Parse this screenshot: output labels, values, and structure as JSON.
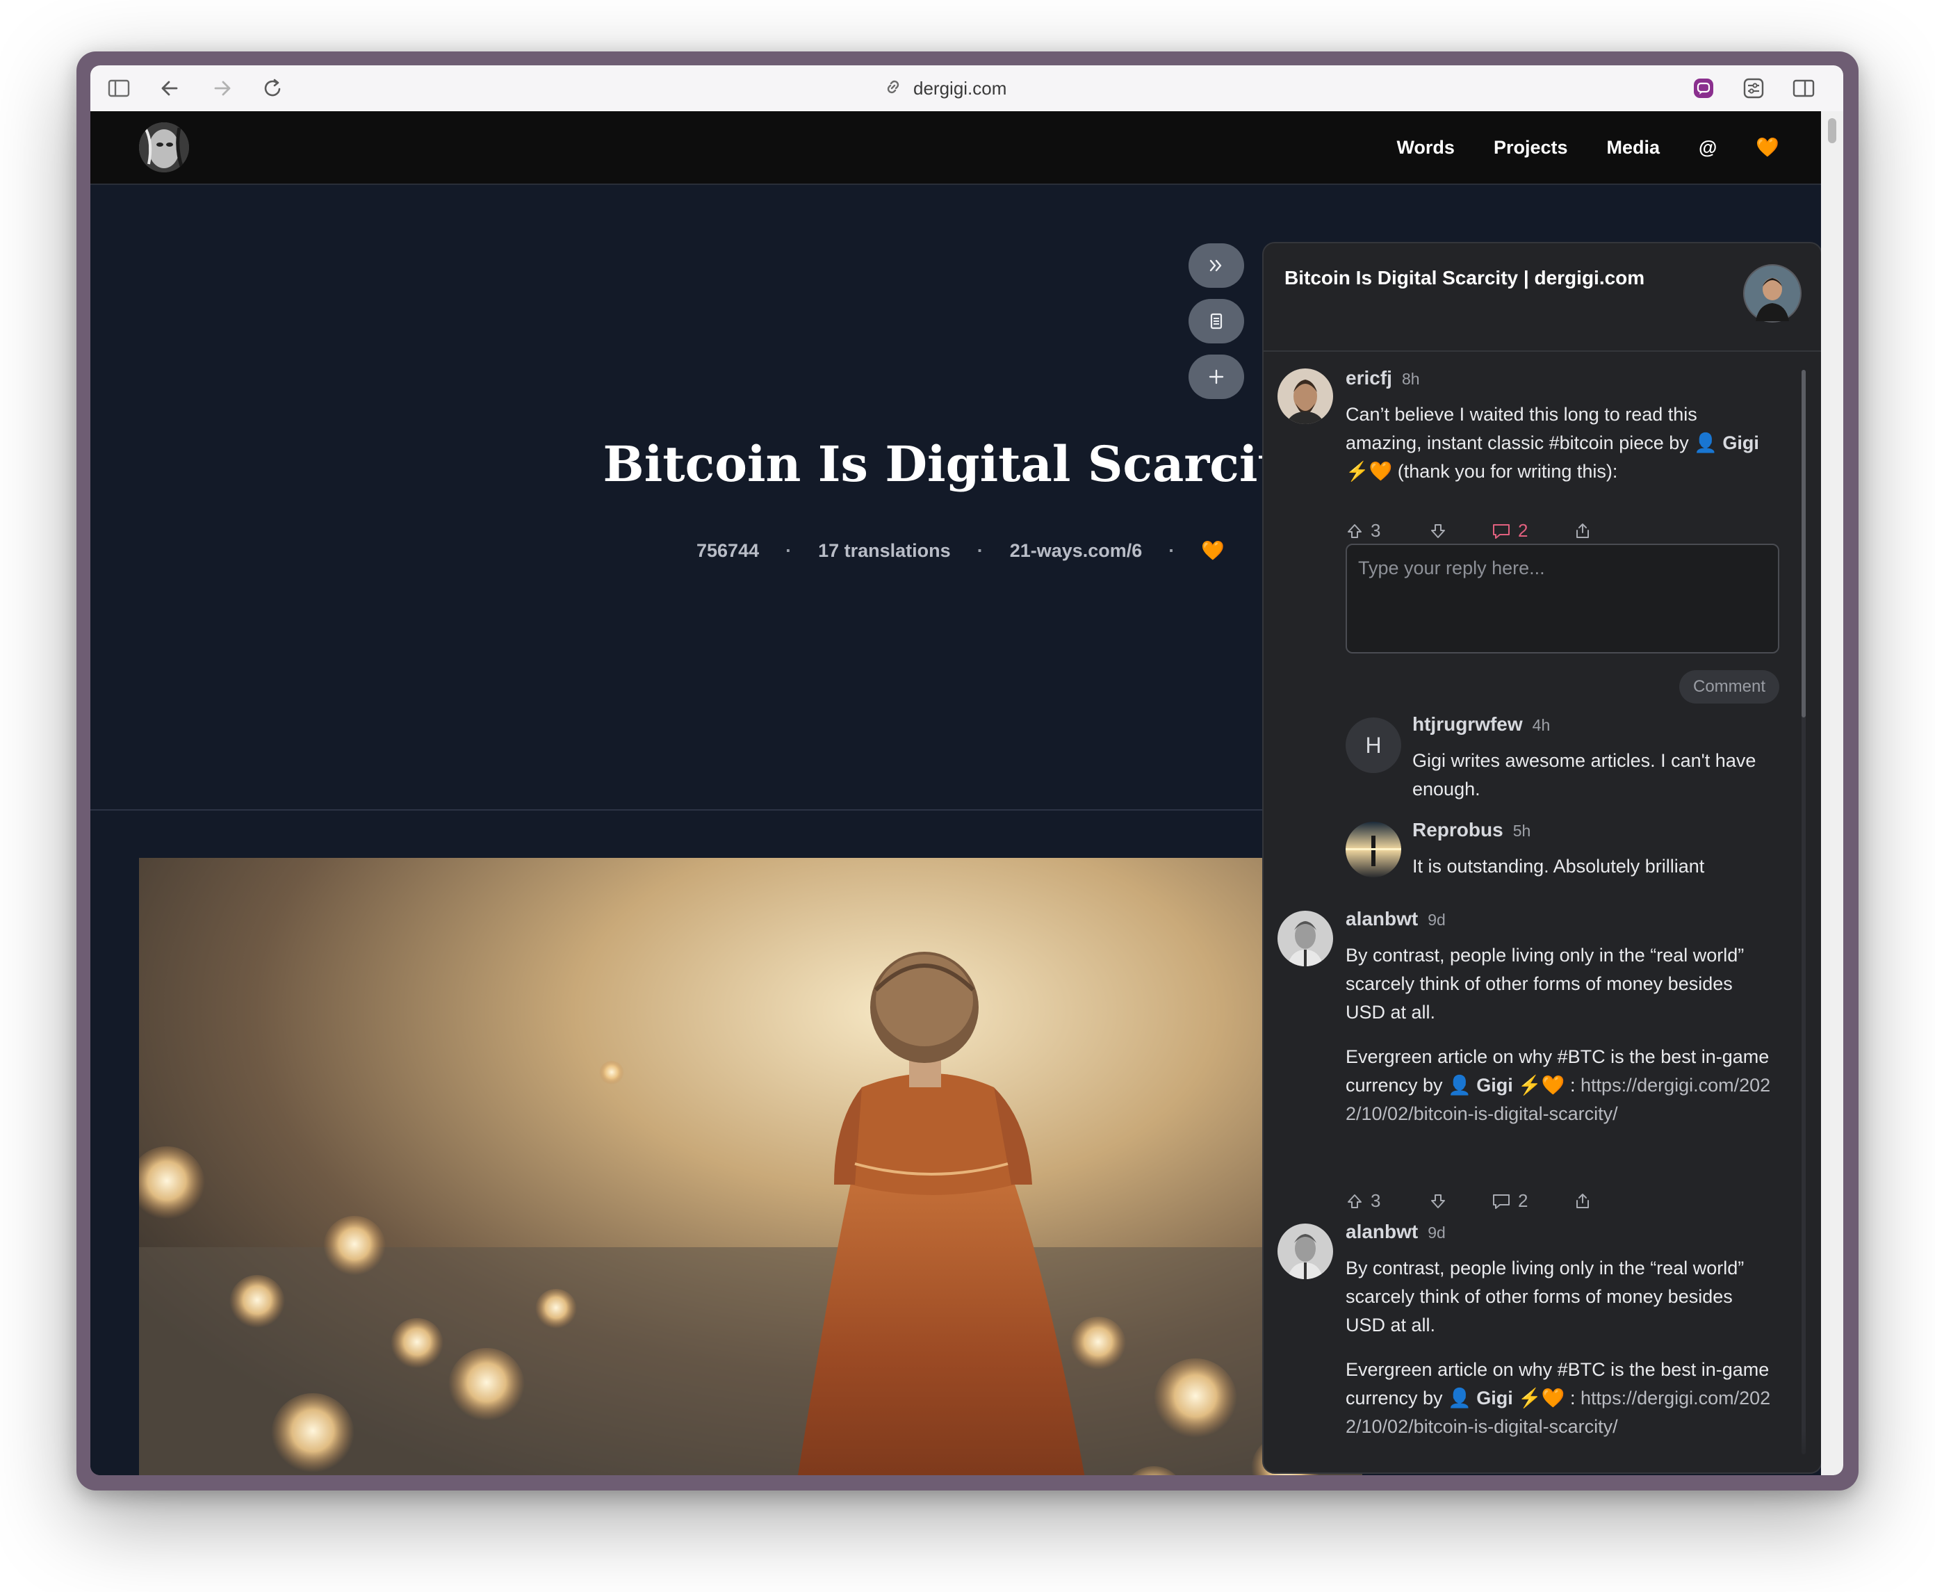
{
  "browser": {
    "url": "dergigi.com"
  },
  "site": {
    "nav": [
      "Words",
      "Projects",
      "Media",
      "@",
      "🧡"
    ]
  },
  "article": {
    "title": "Bitcoin Is Digital Scarcity",
    "meta": {
      "block_height": "756744",
      "translations": "17 translations",
      "short_link": "21-ways.com/6",
      "heart": "🧡"
    }
  },
  "panel": {
    "title": "Bitcoin Is Digital Scarcity | dergigi.com",
    "reply_placeholder": "Type your reply here...",
    "comment_button": "Comment",
    "comments": [
      {
        "author": "ericfj",
        "time": "8h",
        "text_before": "Can’t believe I waited this long to read this amazing, instant classic #bitcoin piece by",
        "mention": "Gigi",
        "mention_suffix": "⚡🧡",
        "text_after": "(thank you for writing this):",
        "upvotes": "3",
        "replies": "2"
      },
      {
        "author": "htjrugrwfew",
        "time": "4h",
        "avatar_letter": "H",
        "text": "Gigi writes awesome articles. I can't have enough."
      },
      {
        "author": "Reprobus",
        "time": "5h",
        "text": "It is outstanding. Absolutely brilliant"
      },
      {
        "author": "alanbwt",
        "time": "9d",
        "para1": "By contrast, people living only in the “real world” scarcely think of other forms of money besides USD at all.",
        "para2_before": "Evergreen article on why #BTC is the best in-game currency by",
        "mention": "Gigi",
        "mention_suffix": "⚡🧡",
        "para2_after": ":",
        "link": "https://dergigi.com/2022/10/02/bitcoin-is-digital-scarcity/",
        "upvotes": "3",
        "replies": "2"
      },
      {
        "author": "alanbwt",
        "time": "9d",
        "para1": "By contrast, people living only in the “real world” scarcely think of other forms of money besides USD at all.",
        "para2_before": "Evergreen article on why #BTC is the best in-game currency by",
        "mention": "Gigi",
        "mention_suffix": "⚡🧡",
        "para2_after": ":",
        "link": "https://dergigi.com/2022/10/02/bitcoin-is-digital-scarcity/"
      }
    ]
  },
  "colors": {
    "page_bg": "#131a28",
    "panel_bg": "#232427",
    "reply_accent": "#e0607e",
    "heart": "#f7931a"
  }
}
